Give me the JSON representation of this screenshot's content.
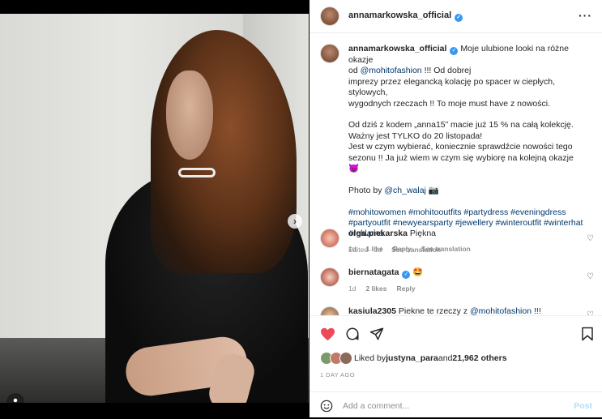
{
  "post_header": {
    "username": "annamarkowska_official"
  },
  "caption": {
    "username": "annamarkowska_official",
    "line1_a": "Moje ulubione looki na różne okazje",
    "line1_b_prefix": "od ",
    "mention_brand": "@mohitofashion",
    "line1_b_suffix": " !!! Od dobrej",
    "line2": "imprezy przez elegancką kolację po spacer w ciepłych, stylowych,",
    "line3": "wygodnych rzeczach !! To moje must have z nowości.",
    "line4": "Od dziś z kodem „anna15” macie już 15 % na całą kolekcję.",
    "line5": "Ważny jest TYLKO do 20 listopada!",
    "line6": "Jest w czym wybierać, koniecznie sprawdźcie nowości tego",
    "line7_text": "sezonu !! Ja już wiem w czym się wybiorę na kolejną okazje",
    "line7_emoji": "😈",
    "photo_by": "Photo by ",
    "photo_mention": "@ch_walaj",
    "photo_emoji": "📷",
    "hashtags_1": "#mohitowomen #mohitooutfits #partydress #eveningdress",
    "hashtags_2": "#partyoutfit #newyearsparty #jewellery #winteroutfit #winterhat",
    "hashtags_3": "#reklama",
    "edited": "Edited · 1d",
    "see_translation": "See translation"
  },
  "comments": [
    {
      "username": "olga.piekarska",
      "text": "Piękna",
      "time": "1d",
      "likes": "1 like",
      "reply": "Reply",
      "translate": "See translation"
    },
    {
      "username": "biernatagata",
      "text": "🤩",
      "time": "1d",
      "likes": "2 likes",
      "reply": "Reply"
    },
    {
      "username": "kasiula2305",
      "text": "Piekne te rzeczy z ",
      "mention": "@mohitofashion",
      "suffix": " !!!"
    }
  ],
  "likes": {
    "prefix": "Liked by ",
    "user": "justyna_para",
    "middle": " and ",
    "count": "21,962 others"
  },
  "date": "1 DAY AGO",
  "add_comment": {
    "placeholder": "Add a comment...",
    "post": "Post"
  },
  "colors": {
    "like_red": "#ed4956",
    "link_blue": "#00376b",
    "verified_blue": "#3897f0"
  }
}
